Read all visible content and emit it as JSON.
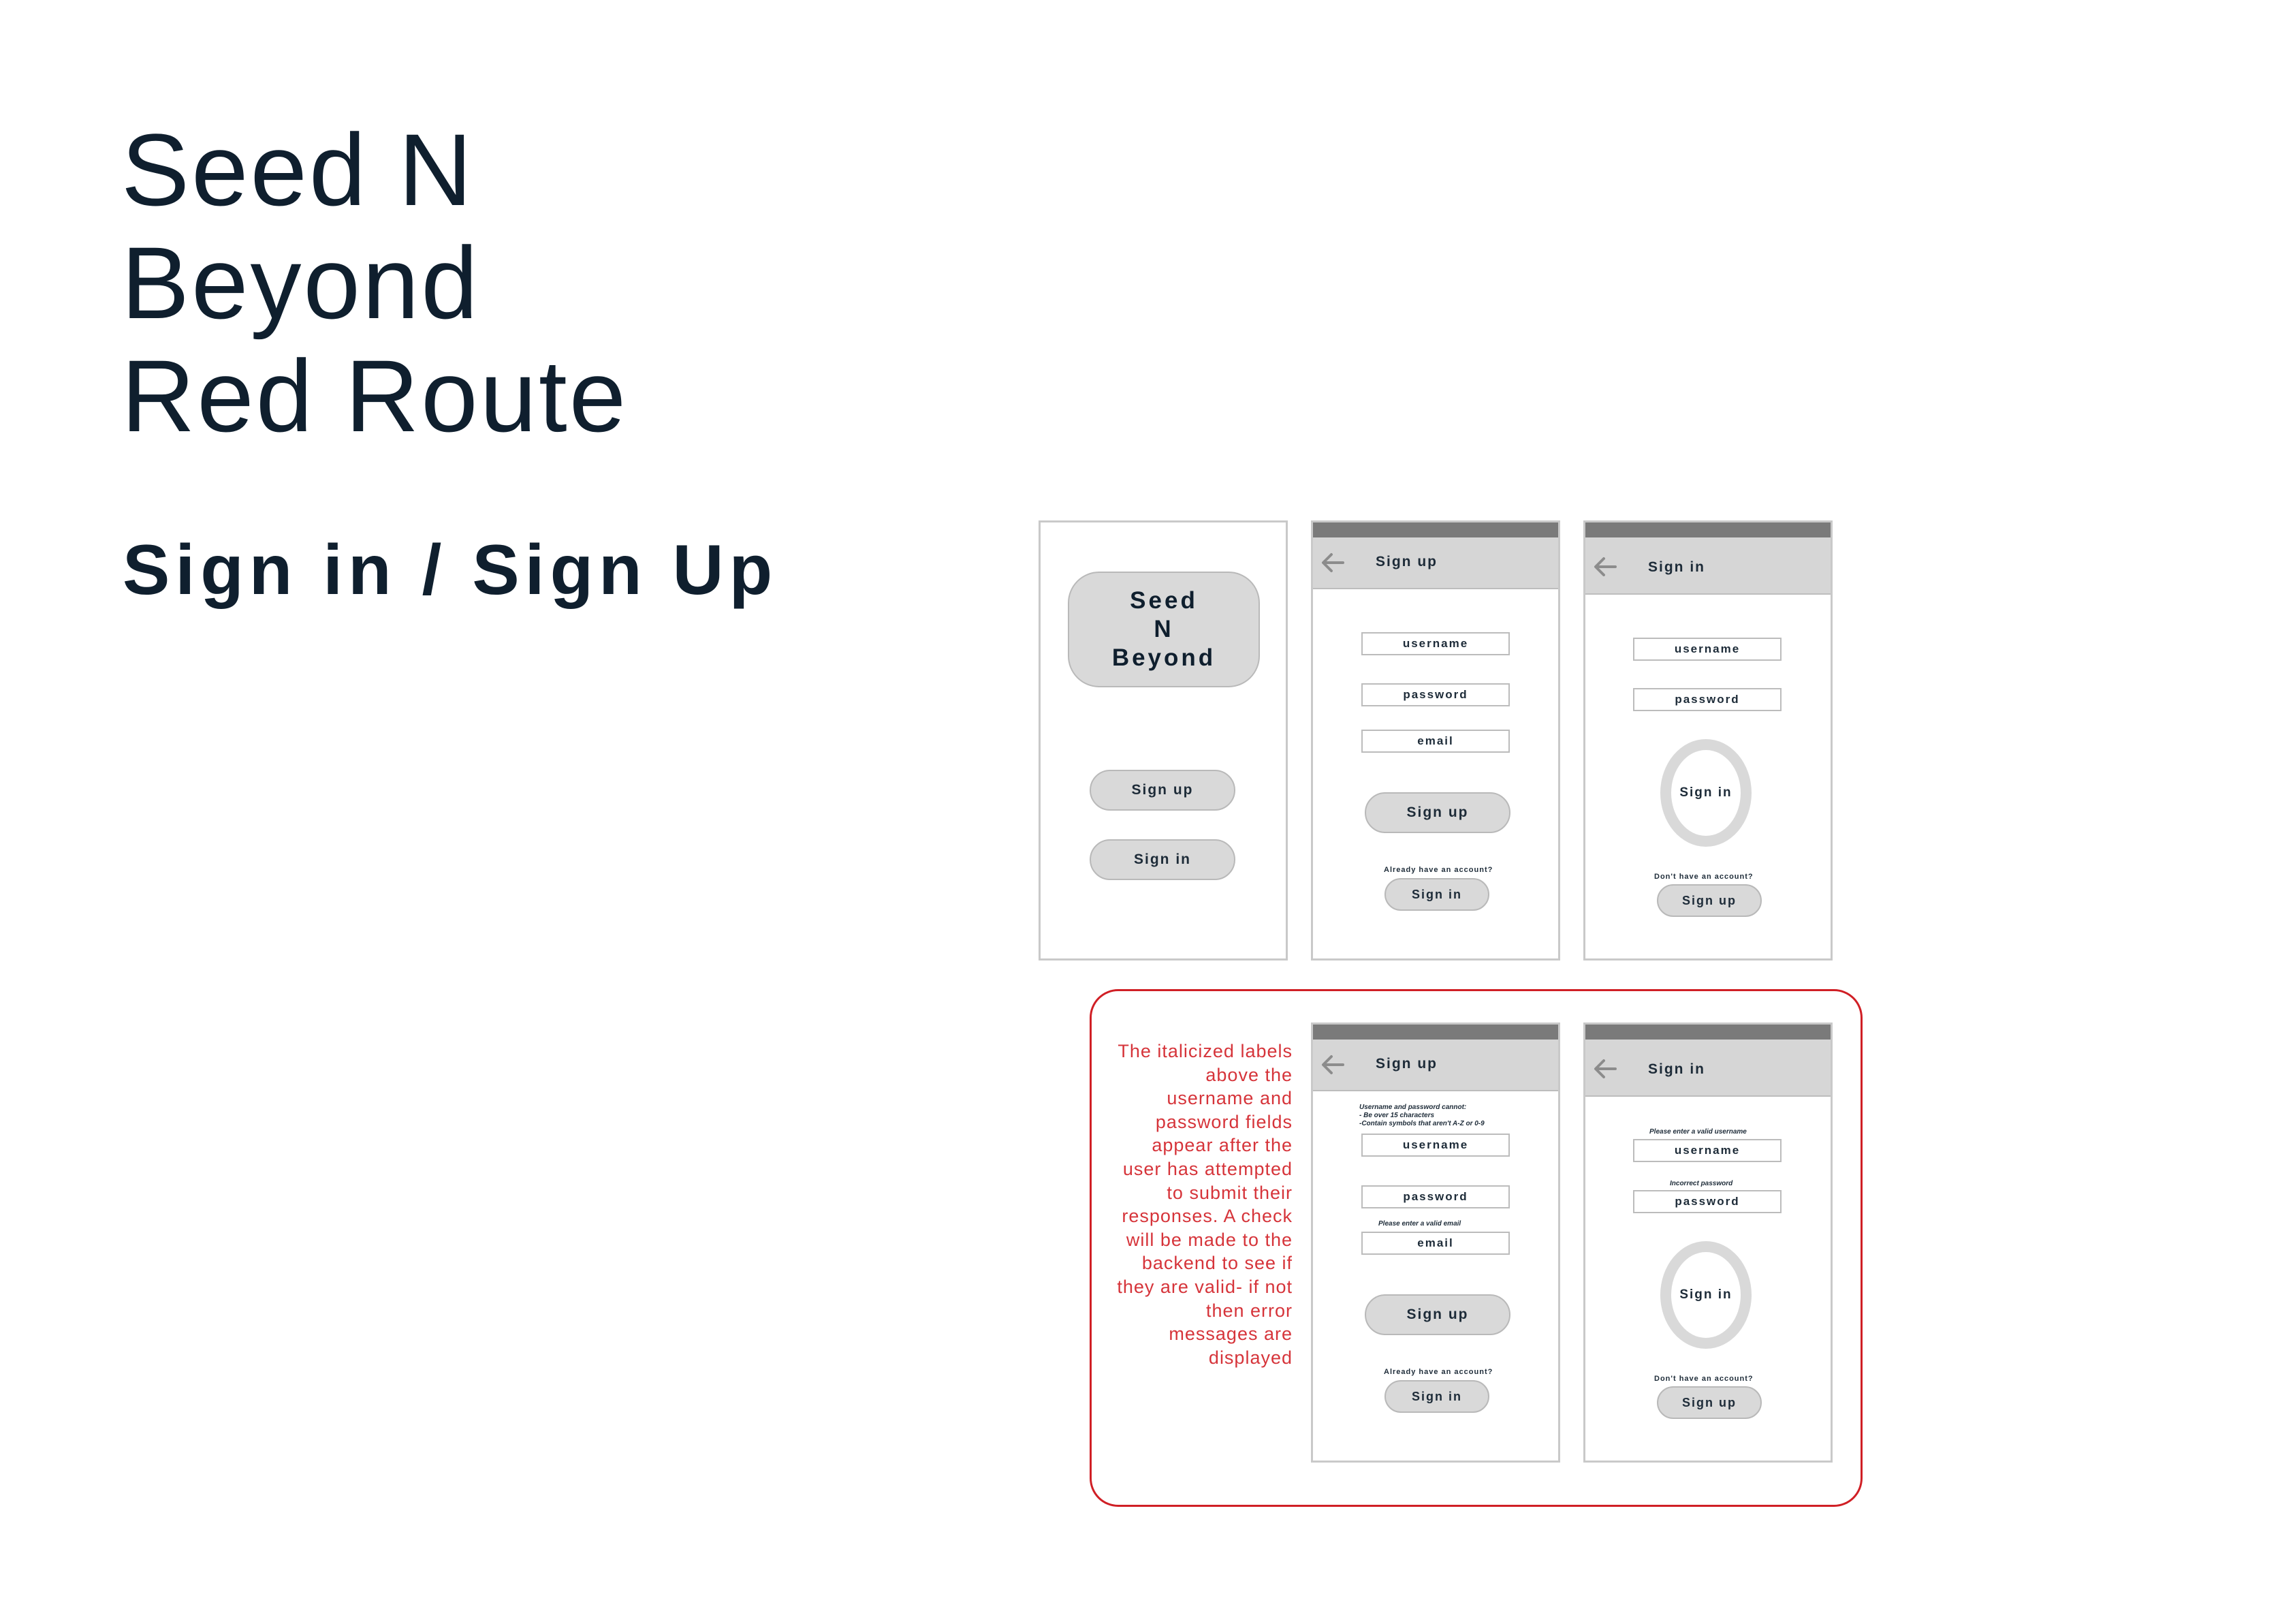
{
  "title_lines": [
    "Seed N",
    "Beyond",
    "Red Route"
  ],
  "subtitle": "Sign in / Sign Up",
  "landing": {
    "logo_lines": [
      "Seed",
      "N",
      "Beyond"
    ],
    "signup_label": "Sign up",
    "signin_label": "Sign in"
  },
  "signup": {
    "header": "Sign up",
    "username": "username",
    "password": "password",
    "email": "email",
    "submit": "Sign up",
    "prompt": "Already have an account?",
    "alt_button": "Sign in"
  },
  "signin": {
    "header": "Sign in",
    "username": "username",
    "password": "password",
    "submit": "Sign in",
    "prompt": "Don't  have an account?",
    "alt_button": "Sign up"
  },
  "signup_errors": {
    "header": "Sign up",
    "rules_line1": "Username  and password cannot:",
    "rules_line2": "- Be over 15 characters",
    "rules_line3": "-Contain symbols that aren't A-Z or 0-9",
    "username": "username",
    "password": "password",
    "email_error": "Please enter a valid email",
    "email": "email",
    "submit": "Sign up",
    "prompt": "Already have an account?",
    "alt_button": "Sign in"
  },
  "signin_errors": {
    "header": "Sign in",
    "username_error": "Please enter a valid username",
    "username": "username",
    "password_error": "Incorrect password",
    "password": "password",
    "submit": "Sign in",
    "prompt": "Don't  have an account?",
    "alt_button": "Sign up"
  },
  "annotation": "The italicized labels above the username and password fields appear after the user has attempted to submit their responses. A check will be made to the backend to see if they are valid- if not then error messages are displayed",
  "colors": {
    "text": "#0f1f2e",
    "annotation_red": "#d01f25",
    "wire_gray": "#d9d9d9",
    "status_bar": "#7a7a7a"
  }
}
